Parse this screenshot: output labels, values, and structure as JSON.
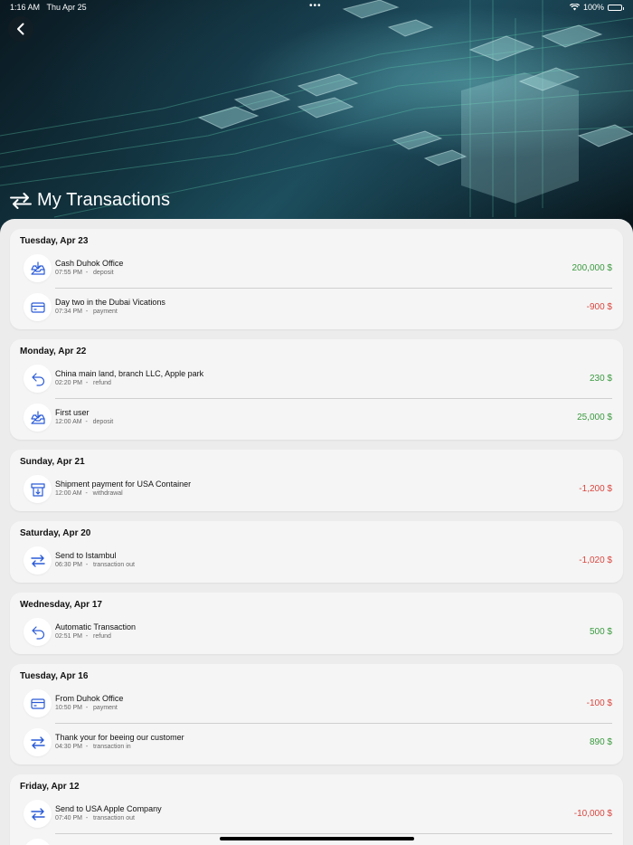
{
  "status": {
    "time": "1:16 AM",
    "date": "Thu Apr 25",
    "battery": "100%"
  },
  "header": {
    "title": "My Transactions"
  },
  "groups": [
    {
      "date": "Tuesday, Apr 23",
      "items": [
        {
          "icon": "deposit-icon",
          "title": "Cash Duhok Office",
          "time": "07:55 PM",
          "type": "deposit",
          "amount": "200,000 $",
          "sign": "pos"
        },
        {
          "icon": "card-icon",
          "title": "Day two in the Dubai Vications",
          "time": "07:34 PM",
          "type": "payment",
          "amount": "-900 $",
          "sign": "neg"
        }
      ]
    },
    {
      "date": "Monday, Apr 22",
      "items": [
        {
          "icon": "refund-icon",
          "title": "China main land, branch LLC, Apple park",
          "time": "02:20 PM",
          "type": "refund",
          "amount": "230 $",
          "sign": "pos"
        },
        {
          "icon": "deposit-icon",
          "title": "First user",
          "time": "12:00 AM",
          "type": "deposit",
          "amount": "25,000 $",
          "sign": "pos"
        }
      ]
    },
    {
      "date": "Sunday, Apr 21",
      "items": [
        {
          "icon": "withdrawal-icon",
          "title": "Shipment payment for USA Container",
          "time": "12:00 AM",
          "type": "withdrawal",
          "amount": "-1,200 $",
          "sign": "neg"
        }
      ]
    },
    {
      "date": "Saturday, Apr 20",
      "items": [
        {
          "icon": "transfer-icon",
          "title": "Send to Istambul",
          "time": "06:30 PM",
          "type": "transaction_out",
          "amount": "-1,020 $",
          "sign": "neg"
        }
      ]
    },
    {
      "date": "Wednesday, Apr 17",
      "items": [
        {
          "icon": "refund-icon",
          "title": "Automatic Transaction",
          "time": "02:51 PM",
          "type": "refund",
          "amount": "500 $",
          "sign": "pos"
        }
      ]
    },
    {
      "date": "Tuesday, Apr 16",
      "items": [
        {
          "icon": "card-icon",
          "title": "From Duhok Office",
          "time": "10:50 PM",
          "type": "payment",
          "amount": "-100 $",
          "sign": "neg"
        },
        {
          "icon": "transfer-icon",
          "title": "Thank your for beeing our customer",
          "time": "04:30 PM",
          "type": "transaction_in",
          "amount": "890 $",
          "sign": "pos"
        }
      ]
    },
    {
      "date": "Friday, Apr 12",
      "items": [
        {
          "icon": "transfer-icon",
          "title": "Send to USA Apple Company",
          "time": "07:40 PM",
          "type": "transaction_out",
          "amount": "-10,000 $",
          "sign": "neg"
        },
        {
          "icon": "deposit-icon",
          "title": "",
          "time": "",
          "type": "",
          "amount": "",
          "sign": "pos"
        }
      ]
    }
  ],
  "colors": {
    "positive": "#3a9a3f",
    "negative": "#d9463f",
    "icon": "#2a5bd7"
  }
}
